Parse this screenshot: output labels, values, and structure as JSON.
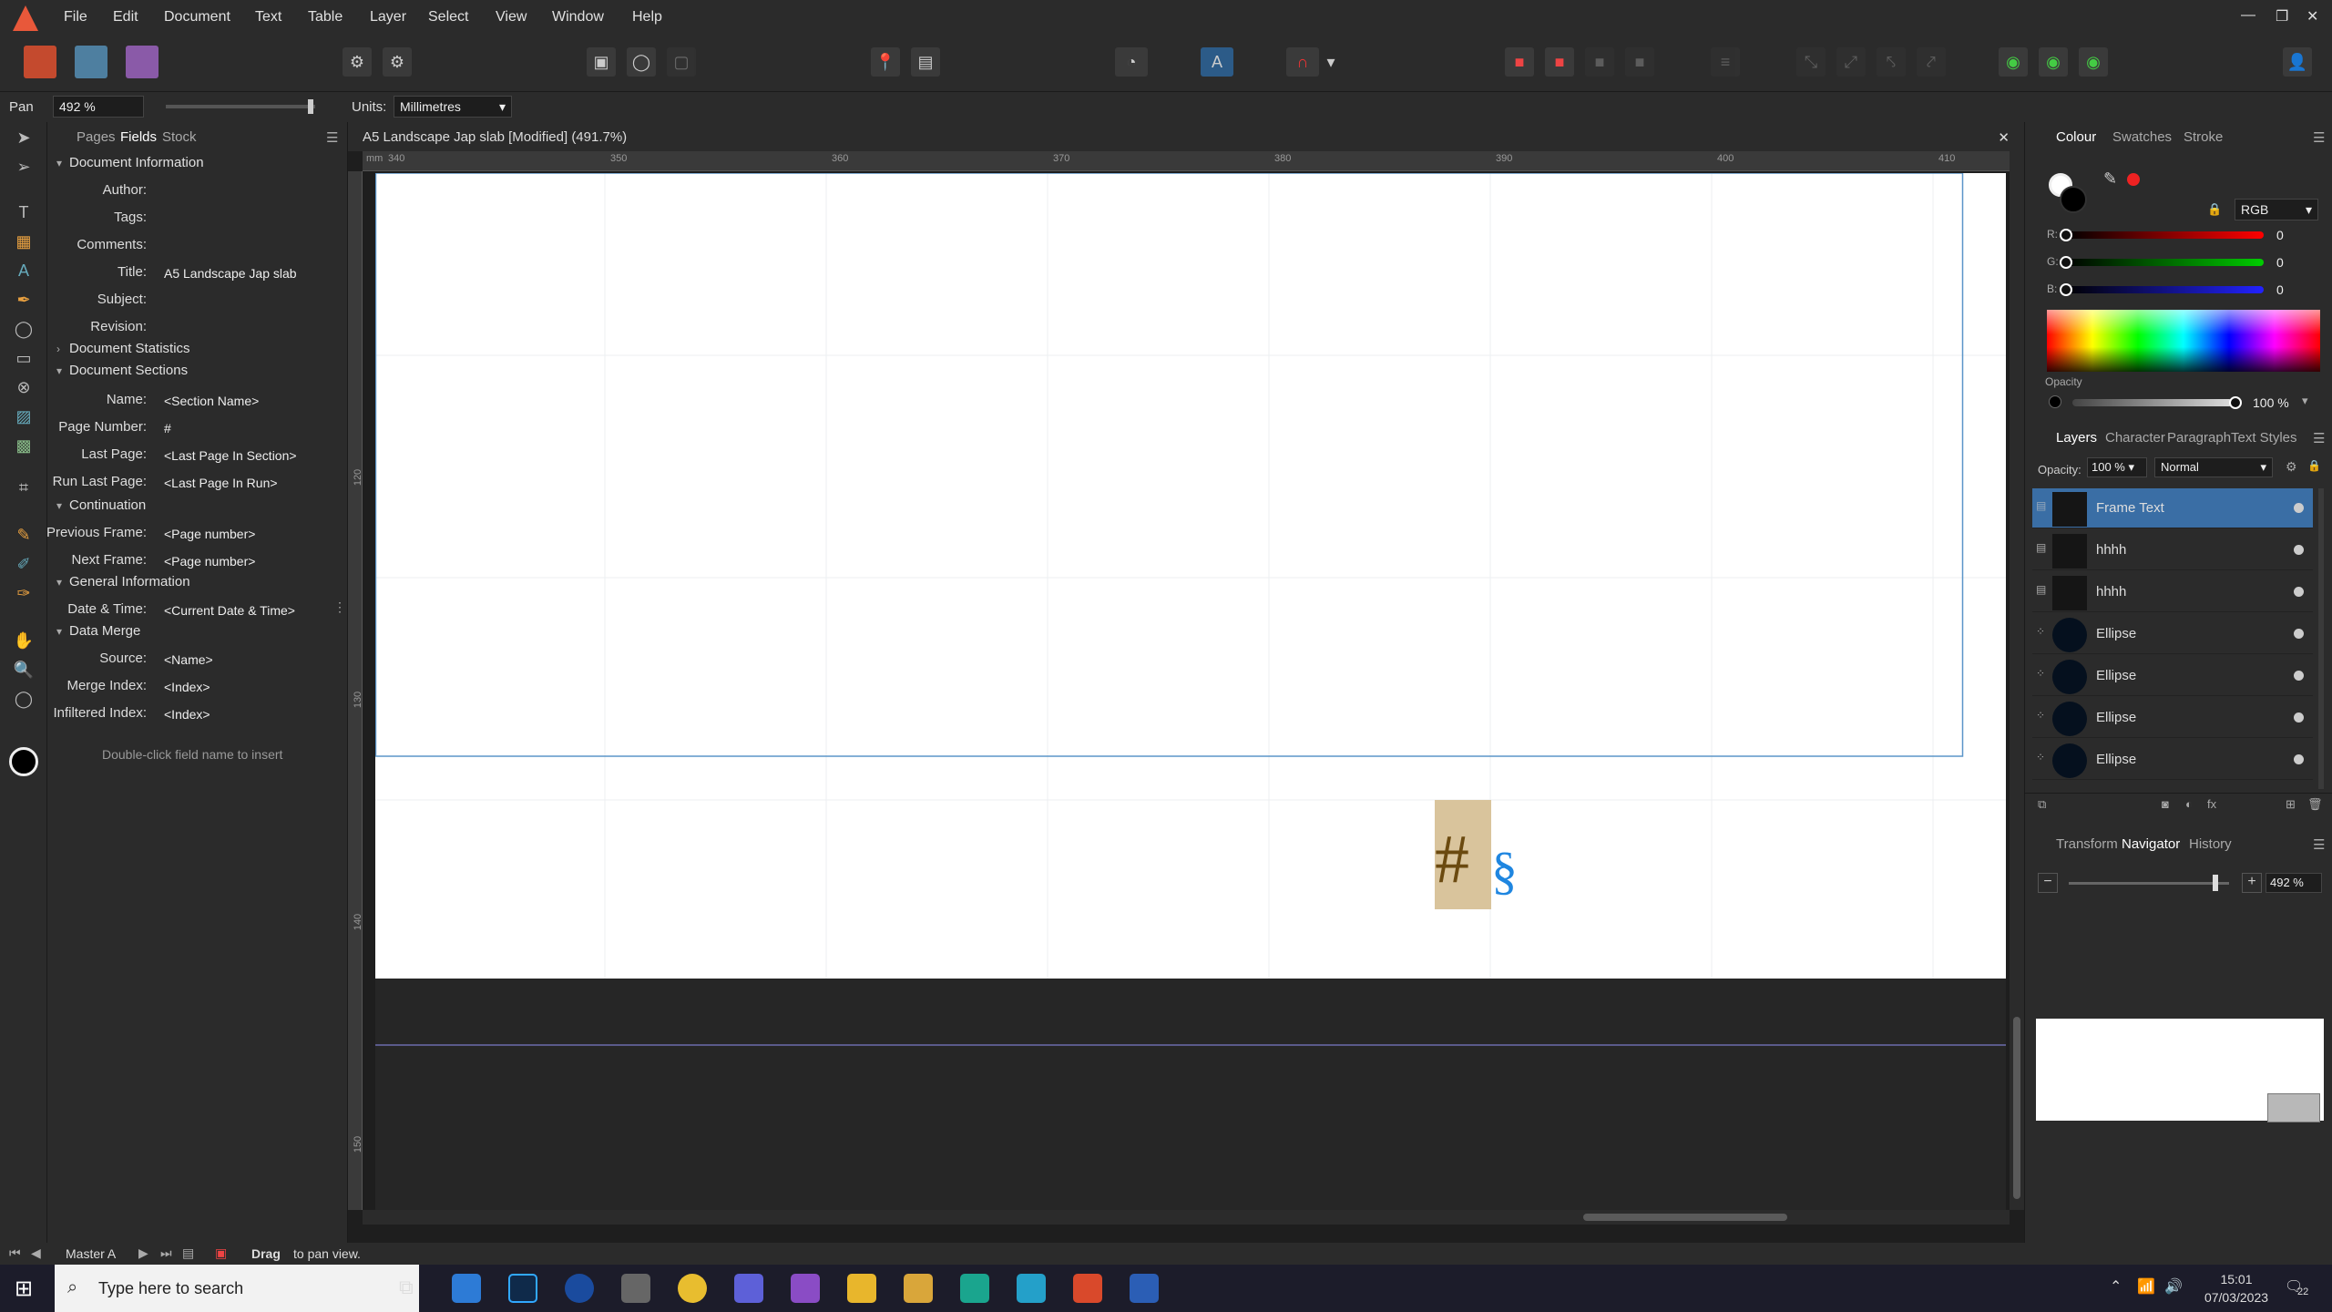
{
  "menu": [
    "File",
    "Edit",
    "Document",
    "Text",
    "Table",
    "Layer",
    "Select",
    "View",
    "Window",
    "Help"
  ],
  "context": {
    "tool": "Pan",
    "zoom": "492 %",
    "units_label": "Units:",
    "units_value": "Millimetres"
  },
  "fields_panel": {
    "tabs": [
      "Pages",
      "Fields",
      "Stock"
    ],
    "sections": {
      "doc_info": "Document Information",
      "doc_stats": "Document Statistics",
      "doc_sections": "Document Sections",
      "continuation": "Continuation",
      "general_info": "General Information",
      "data_merge": "Data Merge"
    },
    "doc_info_rows": [
      {
        "label": "Author:",
        "value": ""
      },
      {
        "label": "Tags:",
        "value": ""
      },
      {
        "label": "Comments:",
        "value": ""
      },
      {
        "label": "Title:",
        "value": "A5 Landscape Jap slab"
      },
      {
        "label": "Subject:",
        "value": ""
      },
      {
        "label": "Revision:",
        "value": ""
      }
    ],
    "section_rows": [
      {
        "label": "Name:",
        "value": "<Section Name>"
      },
      {
        "label": "Page Number:",
        "value": "#"
      },
      {
        "label": "Last Page:",
        "value": "<Last Page In Section>"
      },
      {
        "label": "Run Last Page:",
        "value": "<Last Page In Run>"
      }
    ],
    "continuation_rows": [
      {
        "label": "Previous Frame:",
        "value": "<Page number>"
      },
      {
        "label": "Next Frame:",
        "value": "<Page number>"
      }
    ],
    "general_rows": [
      {
        "label": "Date & Time:",
        "value": "<Current Date & Time>"
      }
    ],
    "merge_rows": [
      {
        "label": "Source:",
        "value": "<Name>"
      },
      {
        "label": "Merge Index:",
        "value": "<Index>"
      },
      {
        "label": "Infiltered Index:",
        "value": "<Index>"
      }
    ],
    "hint": "Double-click field name to insert"
  },
  "document": {
    "title": "A5 Landscape Jap slab [Modified] (491.7%)",
    "ruler_top": [
      "340",
      "350",
      "360",
      "370",
      "380",
      "390",
      "400",
      "410"
    ],
    "ruler_left": [
      "120",
      "130",
      "140",
      "150"
    ],
    "hash_glyph": "#",
    "section_glyph": "§"
  },
  "colour_panel": {
    "tabs": [
      "Colour",
      "Swatches",
      "Stroke"
    ],
    "model": "RGB",
    "r_label": "R:",
    "g_label": "G:",
    "b_label": "B:",
    "r": "0",
    "g": "0",
    "b": "0",
    "opacity_label": "Opacity",
    "opacity": "100 %"
  },
  "layers_panel": {
    "tabs": [
      "Layers",
      "Character",
      "Paragraph",
      "Text Styles"
    ],
    "opacity_label": "Opacity:",
    "opacity": "100 %",
    "blend": "Normal",
    "layers": [
      "Frame Text",
      "hhhh",
      "hhhh",
      "Ellipse",
      "Ellipse",
      "Ellipse",
      "Ellipse"
    ]
  },
  "nav_panel": {
    "tabs": [
      "Transform",
      "Navigator",
      "History"
    ],
    "zoom": "492 %"
  },
  "status": {
    "master": "Master A",
    "hint_bold": "Drag",
    "hint": "to pan view."
  },
  "taskbar": {
    "search_placeholder": "Type here to search",
    "time": "15:01",
    "date": "07/03/2023",
    "notifications": "22"
  }
}
